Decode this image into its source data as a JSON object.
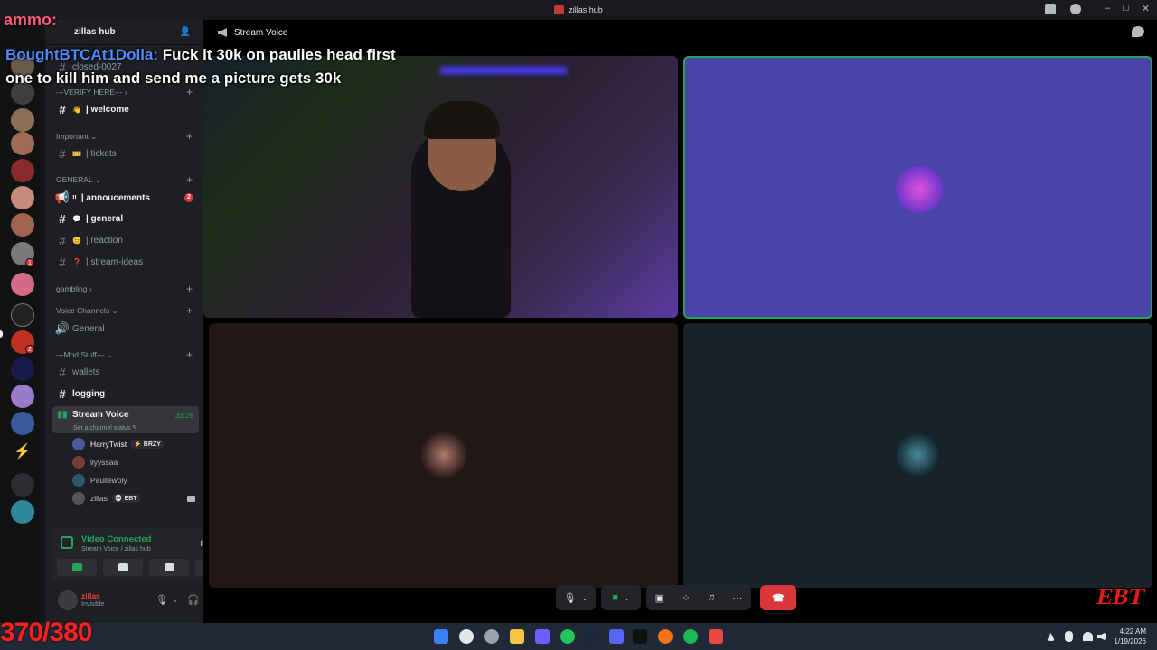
{
  "window": {
    "title": "zillas hub"
  },
  "server": {
    "name": "zillas hub"
  },
  "channels": [
    {
      "name": "closed-0027",
      "type": "text",
      "emoji": ""
    },
    {
      "name": "| welcome",
      "type": "text",
      "emoji": "👋"
    },
    {
      "name": "| tickets",
      "type": "text",
      "emoji": "🎫"
    },
    {
      "name": "| annoucements",
      "type": "announce",
      "emoji": "‼",
      "mentions": "2"
    },
    {
      "name": "| general",
      "type": "text",
      "emoji": "💬"
    },
    {
      "name": "| reaction",
      "type": "text",
      "emoji": "😊"
    },
    {
      "name": "| stream-ideas",
      "type": "text",
      "emoji": "❓"
    },
    {
      "name": "General",
      "type": "voice"
    },
    {
      "name": "wallets",
      "type": "text"
    },
    {
      "name": "logging",
      "type": "text"
    },
    {
      "name": "Stream Voice",
      "type": "voice",
      "duration": "33:26"
    }
  ],
  "categories": {
    "verify": "---VERIFY HERE---",
    "important": "Important",
    "general": "GENERAL",
    "gambling": "gambling",
    "voice": "Voice Channels",
    "mod": "---Mod Stuff---"
  },
  "voice_status_placeholder": "Set a channel status",
  "voice_users": [
    {
      "name": "HarryTwist",
      "tag": "⚡ BRZY",
      "color": "#4a5a9a"
    },
    {
      "name": "llyyssaa",
      "tag": "",
      "color": "#7a3a3a"
    },
    {
      "name": "Paullewoly",
      "tag": "",
      "color": "#2e5a6a"
    },
    {
      "name": "zillas",
      "tag": "💀 EBT",
      "color": "#555"
    }
  ],
  "voice_panel": {
    "status": "Video Connected",
    "location": "Stream Voice / zillas hub"
  },
  "user": {
    "name": "zillas",
    "status": "Invisible"
  },
  "stage": {
    "channel_name": "Stream Voice"
  },
  "overlay": {
    "counter": "370/380",
    "top_text": "ammo:",
    "chat_author": "BoughtBTCAt1Dolla:",
    "chat_message": "Fuck it 30k on paulies head first one to kill him and send me a picture gets 30k"
  },
  "ebt_logo": "EBT",
  "clock": {
    "time": "4:22 AM",
    "date": "1/19/2026"
  },
  "colors": {
    "accent_green": "#23a55a",
    "danger": "#da373c",
    "tile_purple": "#4a43a8",
    "tile_brown": "#211715",
    "tile_slate": "#17222b"
  }
}
